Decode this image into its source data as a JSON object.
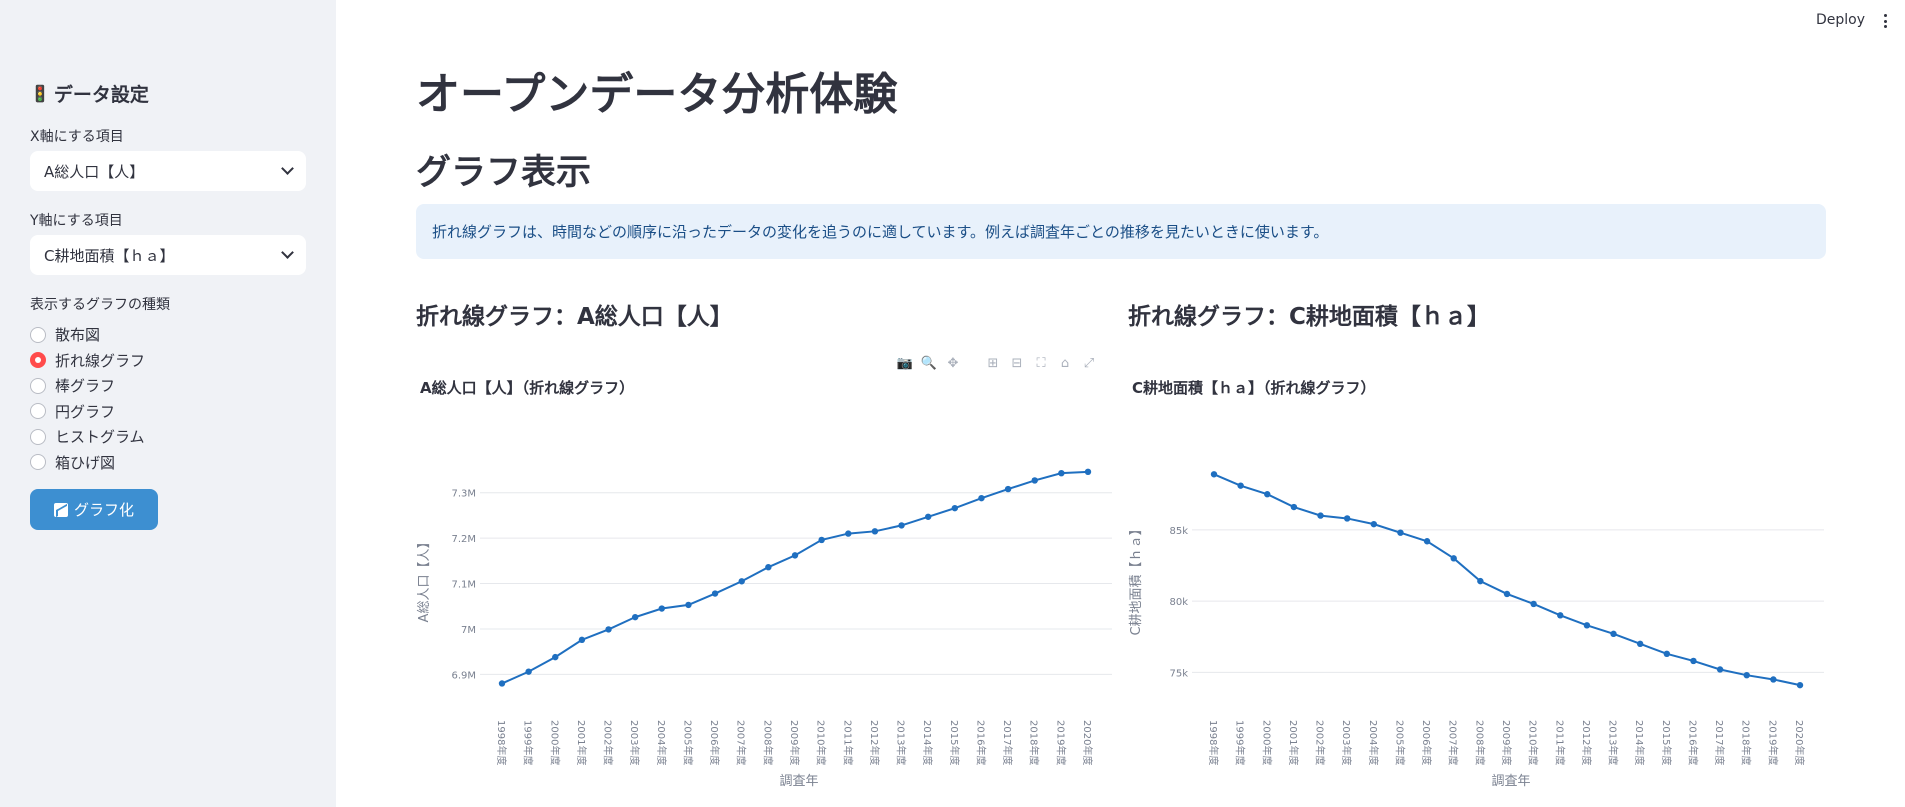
{
  "sidebar": {
    "icon": "traffic-light-icon",
    "title": "データ設定",
    "x_label": "X軸にする項目",
    "x_value": "A総人口【人】",
    "y_label": "Y軸にする項目",
    "y_value": "C耕地面積【ｈａ】",
    "type_label": "表示するグラフの種類",
    "radios": [
      {
        "label": "散布図",
        "selected": false
      },
      {
        "label": "折れ線グラフ",
        "selected": true
      },
      {
        "label": "棒グラフ",
        "selected": false
      },
      {
        "label": "円グラフ",
        "selected": false
      },
      {
        "label": "ヒストグラム",
        "selected": false
      },
      {
        "label": "箱ひげ図",
        "selected": false
      }
    ],
    "button_label": "グラフ化",
    "button_icon": "chart-icon"
  },
  "header": {
    "deploy": "Deploy"
  },
  "main": {
    "title": "オープンデータ分析体験",
    "subtitle": "グラフ表示",
    "info": "折れ線グラフは、時間などの順序に沿ったデータの変化を追うのに適しています。例えば調査年ごとの推移を見たいときに使います。",
    "left_heading": "折れ線グラフ：A総人口【人】",
    "right_heading": "折れ線グラフ：C耕地面積【ｈａ】"
  },
  "chart_data": [
    {
      "type": "line",
      "title": "A総人口【人】（折れ線グラフ）",
      "xlabel": "調査年",
      "ylabel": "A総人口【人】",
      "categories": [
        "1998年度",
        "1999年度",
        "2000年度",
        "2001年度",
        "2002年度",
        "2003年度",
        "2004年度",
        "2005年度",
        "2006年度",
        "2007年度",
        "2008年度",
        "2009年度",
        "2010年度",
        "2011年度",
        "2012年度",
        "2013年度",
        "2014年度",
        "2015年度",
        "2016年度",
        "2017年度",
        "2018年度",
        "2019年度",
        "2020年度"
      ],
      "values": [
        6880000,
        6906000,
        6938000,
        6976000,
        6999000,
        7026000,
        7045000,
        7053000,
        7078000,
        7105000,
        7136000,
        7162000,
        7196000,
        7210000,
        7215000,
        7228000,
        7247000,
        7266000,
        7288000,
        7308000,
        7327000,
        7343000,
        7346000
      ],
      "ylim": [
        6870000,
        7350000
      ],
      "yticks": [
        6900000,
        7000000,
        7100000,
        7200000,
        7300000
      ],
      "yticklabels": [
        "6.9M",
        "7M",
        "7.1M",
        "7.2M",
        "7.3M"
      ],
      "color": "#1f6fc0",
      "grid": true
    },
    {
      "type": "line",
      "title": "C耕地面積【ｈａ】（折れ線グラフ）",
      "xlabel": "調査年",
      "ylabel": "C耕地面積【ｈａ】",
      "categories": [
        "1998年度",
        "1999年度",
        "2000年度",
        "2001年度",
        "2002年度",
        "2003年度",
        "2004年度",
        "2005年度",
        "2006年度",
        "2007年度",
        "2008年度",
        "2009年度",
        "2010年度",
        "2011年度",
        "2012年度",
        "2013年度",
        "2014年度",
        "2015年度",
        "2016年度",
        "2017年度",
        "2018年度",
        "2019年度",
        "2020年度"
      ],
      "values": [
        88900,
        88100,
        87500,
        86600,
        86000,
        85800,
        85400,
        84800,
        84200,
        83000,
        81400,
        80500,
        79800,
        79000,
        78300,
        77700,
        77000,
        76300,
        75800,
        75200,
        74800,
        74500,
        74100
      ],
      "ylim": [
        73900,
        89200
      ],
      "yticks": [
        75000,
        80000,
        85000
      ],
      "yticklabels": [
        "75k",
        "80k",
        "85k"
      ],
      "color": "#1f6fc0",
      "grid": true
    }
  ]
}
